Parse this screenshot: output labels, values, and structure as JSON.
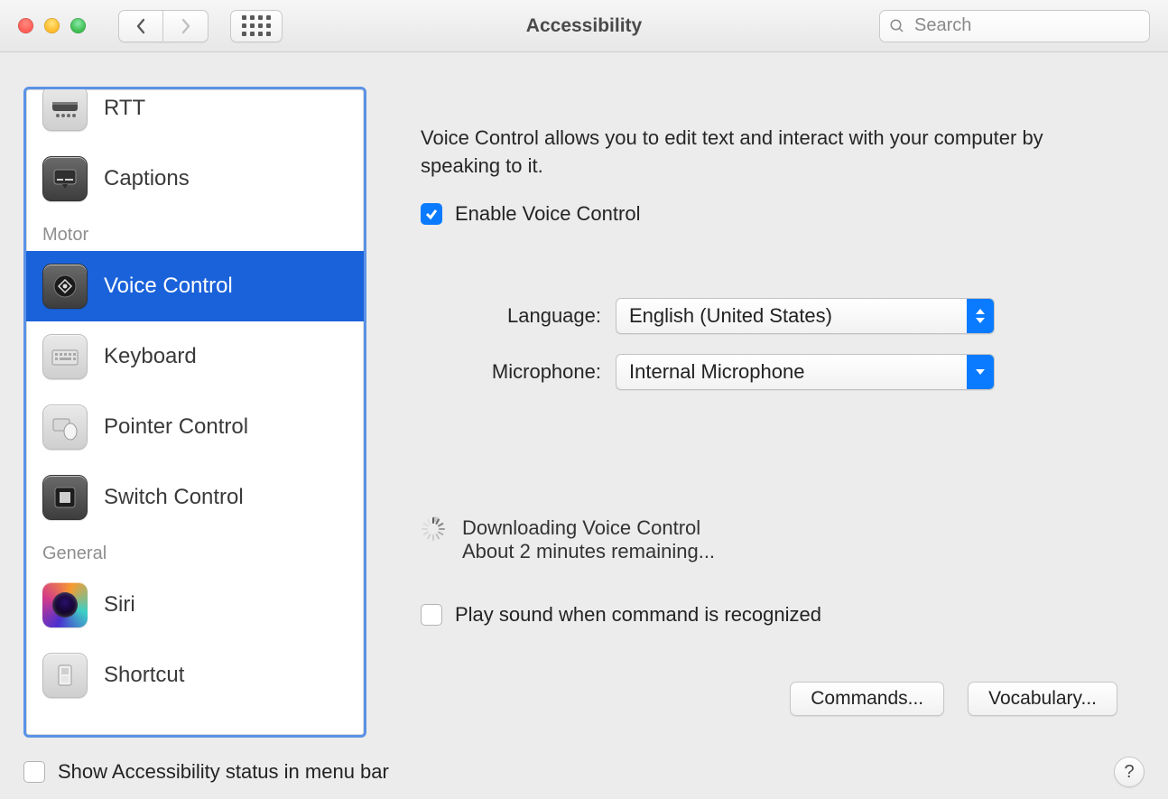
{
  "window": {
    "title": "Accessibility"
  },
  "search": {
    "placeholder": "Search"
  },
  "sidebar": {
    "sections": [
      {
        "items": [
          {
            "label": "RTT",
            "icon": "tty-icon",
            "selected": false
          },
          {
            "label": "Captions",
            "icon": "captions-icon",
            "selected": false
          }
        ]
      },
      {
        "label": "Motor",
        "items": [
          {
            "label": "Voice Control",
            "icon": "voice-control-icon",
            "selected": true
          },
          {
            "label": "Keyboard",
            "icon": "keyboard-icon",
            "selected": false
          },
          {
            "label": "Pointer Control",
            "icon": "pointer-control-icon",
            "selected": false
          },
          {
            "label": "Switch Control",
            "icon": "switch-control-icon",
            "selected": false
          }
        ]
      },
      {
        "label": "General",
        "items": [
          {
            "label": "Siri",
            "icon": "siri-icon",
            "selected": false
          },
          {
            "label": "Shortcut",
            "icon": "shortcut-icon",
            "selected": false
          }
        ]
      }
    ]
  },
  "main": {
    "description": "Voice Control allows you to edit text and interact with your computer by speaking to it.",
    "enable": {
      "label": "Enable Voice Control",
      "checked": true
    },
    "language": {
      "label": "Language:",
      "value": "English (United States)"
    },
    "microphone": {
      "label": "Microphone:",
      "value": "Internal Microphone"
    },
    "download": {
      "title": "Downloading Voice Control",
      "remaining": "About 2 minutes remaining..."
    },
    "play_sound": {
      "label": "Play sound when command is recognized",
      "checked": false
    },
    "commands_button": "Commands...",
    "vocabulary_button": "Vocabulary..."
  },
  "footer": {
    "show_status": {
      "label": "Show Accessibility status in menu bar",
      "checked": false
    }
  }
}
